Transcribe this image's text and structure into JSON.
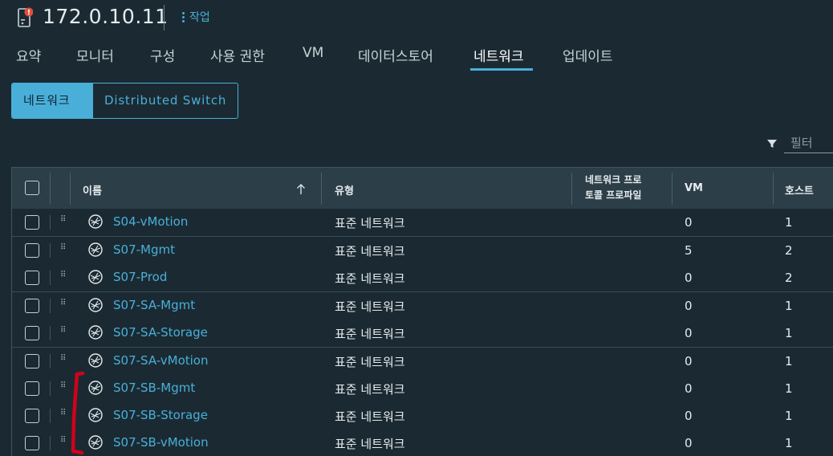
{
  "header": {
    "host_title": "172.0.10.11",
    "actions_label": "작업"
  },
  "tabs": [
    {
      "label": "요약",
      "active": false
    },
    {
      "label": "모니터",
      "active": false
    },
    {
      "label": "구성",
      "active": false
    },
    {
      "label": "사용 권한",
      "active": false
    },
    {
      "label": "VM",
      "active": false
    },
    {
      "label": "데이터스토어",
      "active": false
    },
    {
      "label": "네트워크",
      "active": true
    },
    {
      "label": "업데이트",
      "active": false
    }
  ],
  "segments": {
    "networks": "네트워크",
    "distributed_switch": "Distributed Switch"
  },
  "filter": {
    "placeholder": "필터"
  },
  "grid": {
    "columns": {
      "name": "이름",
      "type": "유형",
      "profile_line1": "네트워크 프로",
      "profile_line2": "토콜 프로파일",
      "vm": "VM",
      "hosts": "호스트"
    },
    "rows": [
      {
        "name": "S04-vMotion",
        "type": "표준 네트워크",
        "vm": "0",
        "hosts": "1"
      },
      {
        "name": "S07-Mgmt",
        "type": "표준 네트워크",
        "vm": "5",
        "hosts": "2"
      },
      {
        "name": "S07-Prod",
        "type": "표준 네트워크",
        "vm": "0",
        "hosts": "2"
      },
      {
        "name": "S07-SA-Mgmt",
        "type": "표준 네트워크",
        "vm": "0",
        "hosts": "1"
      },
      {
        "name": "S07-SA-Storage",
        "type": "표준 네트워크",
        "vm": "0",
        "hosts": "1"
      },
      {
        "name": "S07-SA-vMotion",
        "type": "표준 네트워크",
        "vm": "0",
        "hosts": "1"
      },
      {
        "name": "S07-SB-Mgmt",
        "type": "표준 네트워크",
        "vm": "0",
        "hosts": "1"
      },
      {
        "name": "S07-SB-Storage",
        "type": "표준 네트워크",
        "vm": "0",
        "hosts": "1"
      },
      {
        "name": "S07-SB-vMotion",
        "type": "표준 네트워크",
        "vm": "0",
        "hosts": "1"
      }
    ]
  },
  "icons": {
    "host": "host-icon",
    "alert": "alert-badge-icon",
    "kebab": "kebab-menu-icon",
    "filter": "filter-icon",
    "sort": "sort-ascending-icon",
    "drag": "drag-handle-icon",
    "network": "network-icon"
  },
  "colors": {
    "background": "#1b2a32",
    "accent": "#49afd9",
    "header_row": "#2c3e48",
    "alert": "#e04f3c",
    "annotation": "#d0021b"
  }
}
